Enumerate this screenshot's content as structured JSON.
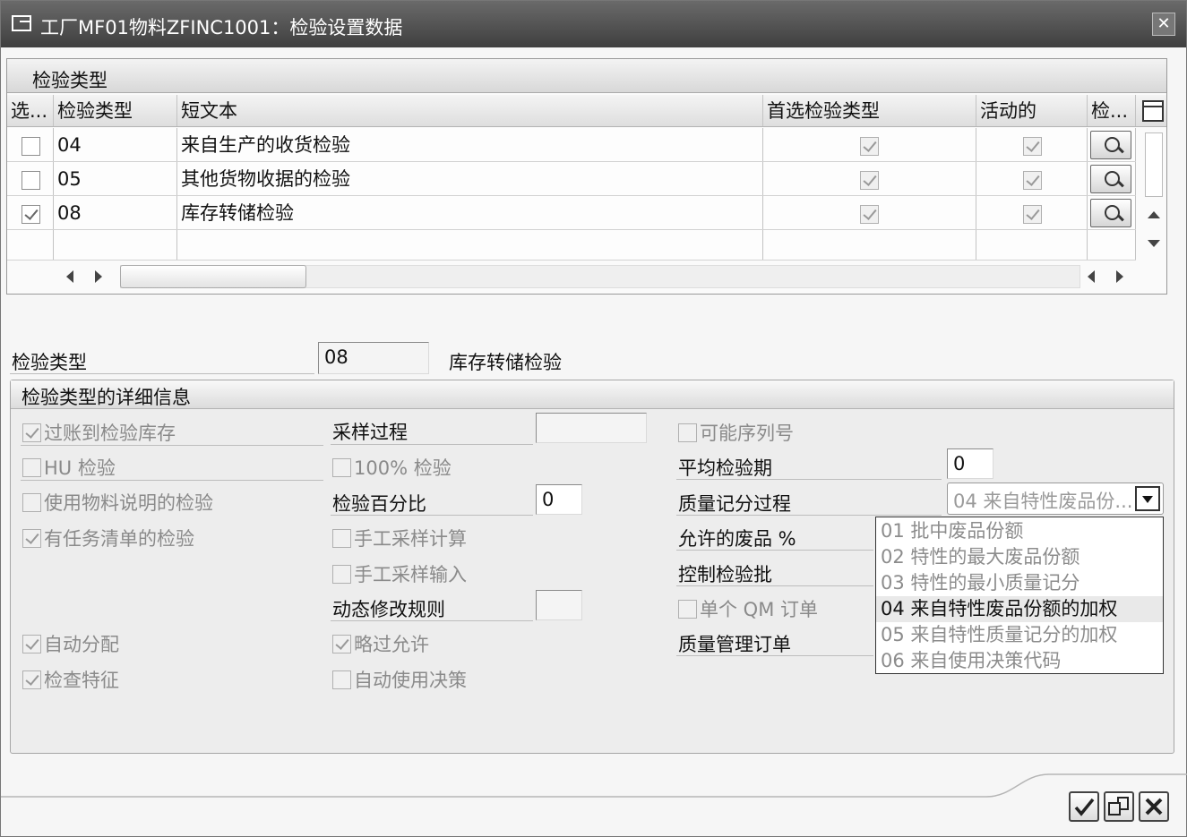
{
  "window": {
    "title": "工厂MF01物料ZFINC1001：检验设置数据",
    "close_glyph": "✕"
  },
  "table": {
    "title": "检验类型",
    "headers": {
      "select": "选...",
      "type": "检验类型",
      "text": "短文本",
      "preferred": "首选检验类型",
      "active": "活动的",
      "inspect": "检..."
    },
    "rows": [
      {
        "selected": false,
        "type": "04",
        "text": "来自生产的收货检验",
        "preferred": true,
        "active": true
      },
      {
        "selected": false,
        "type": "05",
        "text": "其他货物收据的检验",
        "preferred": true,
        "active": true
      },
      {
        "selected": true,
        "type": "08",
        "text": "库存转储检验",
        "preferred": true,
        "active": true
      }
    ]
  },
  "selection": {
    "label": "检验类型",
    "value": "08",
    "description": "库存转储检验"
  },
  "details": {
    "title": "检验类型的详细信息",
    "col1": [
      {
        "label": "过账到检验库存",
        "checked": true
      },
      {
        "label": "HU 检验",
        "checked": false
      },
      {
        "label": "使用物料说明的检验",
        "checked": false
      },
      {
        "label": "有任务清单的检验",
        "checked": true
      },
      {
        "label": "自动分配",
        "checked": true
      },
      {
        "label": "检查特征",
        "checked": true
      }
    ],
    "sampling_procedure_label": "采样过程",
    "sampling_procedure_value": "",
    "full_inspection_label": "100% 检验",
    "inspection_percent_label": "检验百分比",
    "inspection_percent_value": "0",
    "manual_sample_calc_label": "手工采样计算",
    "manual_sample_entry_label": "手工采样输入",
    "dynamic_rule_label": "动态修改规则",
    "dynamic_rule_value": "",
    "skips_allowed_label": "略过允许",
    "auto_usage_decision_label": "自动使用决策",
    "serial_numbers_label": "可能序列号",
    "avg_inspection_period_label": "平均检验期",
    "avg_inspection_period_value": "0",
    "quality_score_label": "质量记分过程",
    "allowed_scrap_label": "允许的废品 %",
    "control_lot_label": "控制检验批",
    "single_qm_order_label": "单个 QM 订单",
    "qm_order_label": "质量管理订单"
  },
  "dropdown": {
    "value": "04 来自特性废品份...",
    "options": [
      "01 批中废品份额",
      "02 特性的最大废品份额",
      "03 特性的最小质量记分",
      "04 来自特性废品份额的加权",
      "05 来自特性质量记分的加权",
      "06 来自使用决策代码"
    ],
    "selected_index": 3
  }
}
